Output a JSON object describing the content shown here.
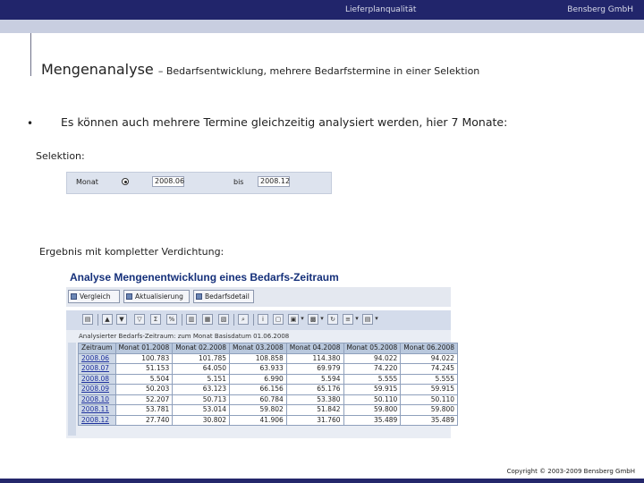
{
  "header": {
    "left": "Lieferplanqualität",
    "right": "Bensberg GmbH"
  },
  "title": {
    "main": "Mengenanalyse",
    "sub": "– Bedarfsentwicklung, mehrere Bedarfstermine in einer Selektion"
  },
  "bullet": {
    "symbol": "•",
    "text": "Es können auch mehrere Termine gleichzeitig analysiert werden, hier 7 Monate:"
  },
  "selection": {
    "heading": "Selektion:",
    "label": "Monat",
    "from": "2008.06",
    "to_label": "bis",
    "to": "2008.12"
  },
  "result": {
    "heading": "Ergebnis mit kompletter Verdichtung:"
  },
  "sap": {
    "title": "Analyse Mengenentwicklung eines Bedarfs-Zeitraum",
    "buttons": [
      "Vergleich",
      "Aktualisierung",
      "Bedarfsdetail"
    ],
    "toolbar_icons": [
      "print-icon",
      "sort-up-icon",
      "sort-down-icon",
      "filter-icon",
      "sum-icon",
      "subtotal-icon",
      "chart-icon",
      "export-icon",
      "layout-icon",
      "find-icon",
      "info-icon",
      "select-icon",
      "detail-icon",
      "settings-icon",
      "refresh-icon",
      "list-icon",
      "graph-icon"
    ],
    "caption": "Analysierter Bedarfs-Zeitraum: zum Monat  Basisdatum 01.06.2008",
    "columns": [
      "Zeitraum",
      "Monat 01.2008",
      "Monat 02.2008",
      "Monat 03.2008",
      "Monat 04.2008",
      "Monat 05.2008",
      "Monat 06.2008"
    ],
    "rows": [
      [
        "2008.06",
        "100.783",
        "101.785",
        "108.858",
        "114.380",
        "94.022",
        "94.022"
      ],
      [
        "2008.07",
        "51.153",
        "64.050",
        "63.933",
        "69.979",
        "74.220",
        "74.245"
      ],
      [
        "2008.08",
        "5.504",
        "5.151",
        "6.990",
        "5.594",
        "5.555",
        "5.555"
      ],
      [
        "2008.09",
        "50.203",
        "63.123",
        "66.156",
        "65.176",
        "59.915",
        "59.915"
      ],
      [
        "2008.10",
        "52.207",
        "50.713",
        "60.784",
        "53.380",
        "50.110",
        "50.110"
      ],
      [
        "2008.11",
        "53.781",
        "53.014",
        "59.802",
        "51.842",
        "59.800",
        "59.800"
      ],
      [
        "2008.12",
        "27.740",
        "30.802",
        "41.906",
        "31.760",
        "35.489",
        "35.489"
      ]
    ]
  },
  "footer": "Copyright © 2003-2009 Bensberg GmbH"
}
